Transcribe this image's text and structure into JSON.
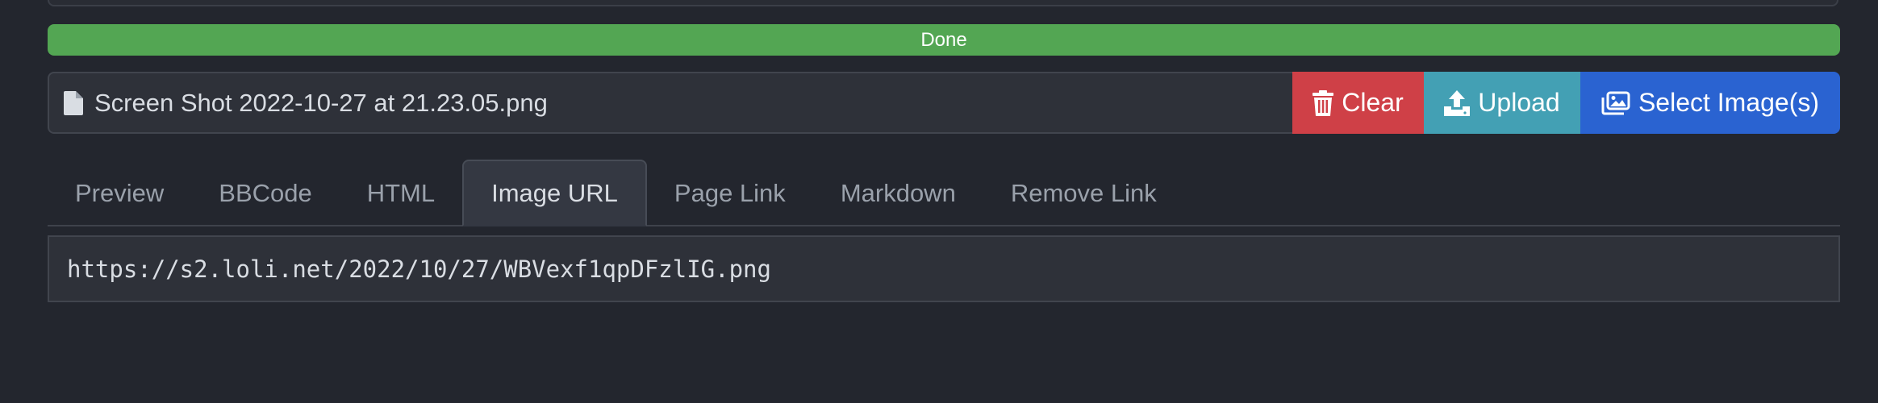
{
  "upload": {
    "progress_label": "Done",
    "progress_fraction": 1.0,
    "file_name": "Screen Shot 2022-10-27 at 21.23.05.png",
    "file_icon": "file-icon"
  },
  "buttons": {
    "clear": {
      "label": "Clear",
      "icon": "trash-icon",
      "color": "#cf4047"
    },
    "upload": {
      "label": "Upload",
      "icon": "upload-icon",
      "color": "#43a0b4"
    },
    "select": {
      "label": "Select Image(s)",
      "icon": "images-icon",
      "color": "#2a63d1"
    }
  },
  "tabs": [
    {
      "label": "Preview",
      "active": false
    },
    {
      "label": "BBCode",
      "active": false
    },
    {
      "label": "HTML",
      "active": false
    },
    {
      "label": "Image URL",
      "active": true
    },
    {
      "label": "Page Link",
      "active": false
    },
    {
      "label": "Markdown",
      "active": false
    },
    {
      "label": "Remove Link",
      "active": false
    }
  ],
  "output": {
    "value": "https://s2.loli.net/2022/10/27/WBVexf1qpDFzlIG.png"
  },
  "colors": {
    "background": "#23262e",
    "progress_success": "#53a653"
  }
}
